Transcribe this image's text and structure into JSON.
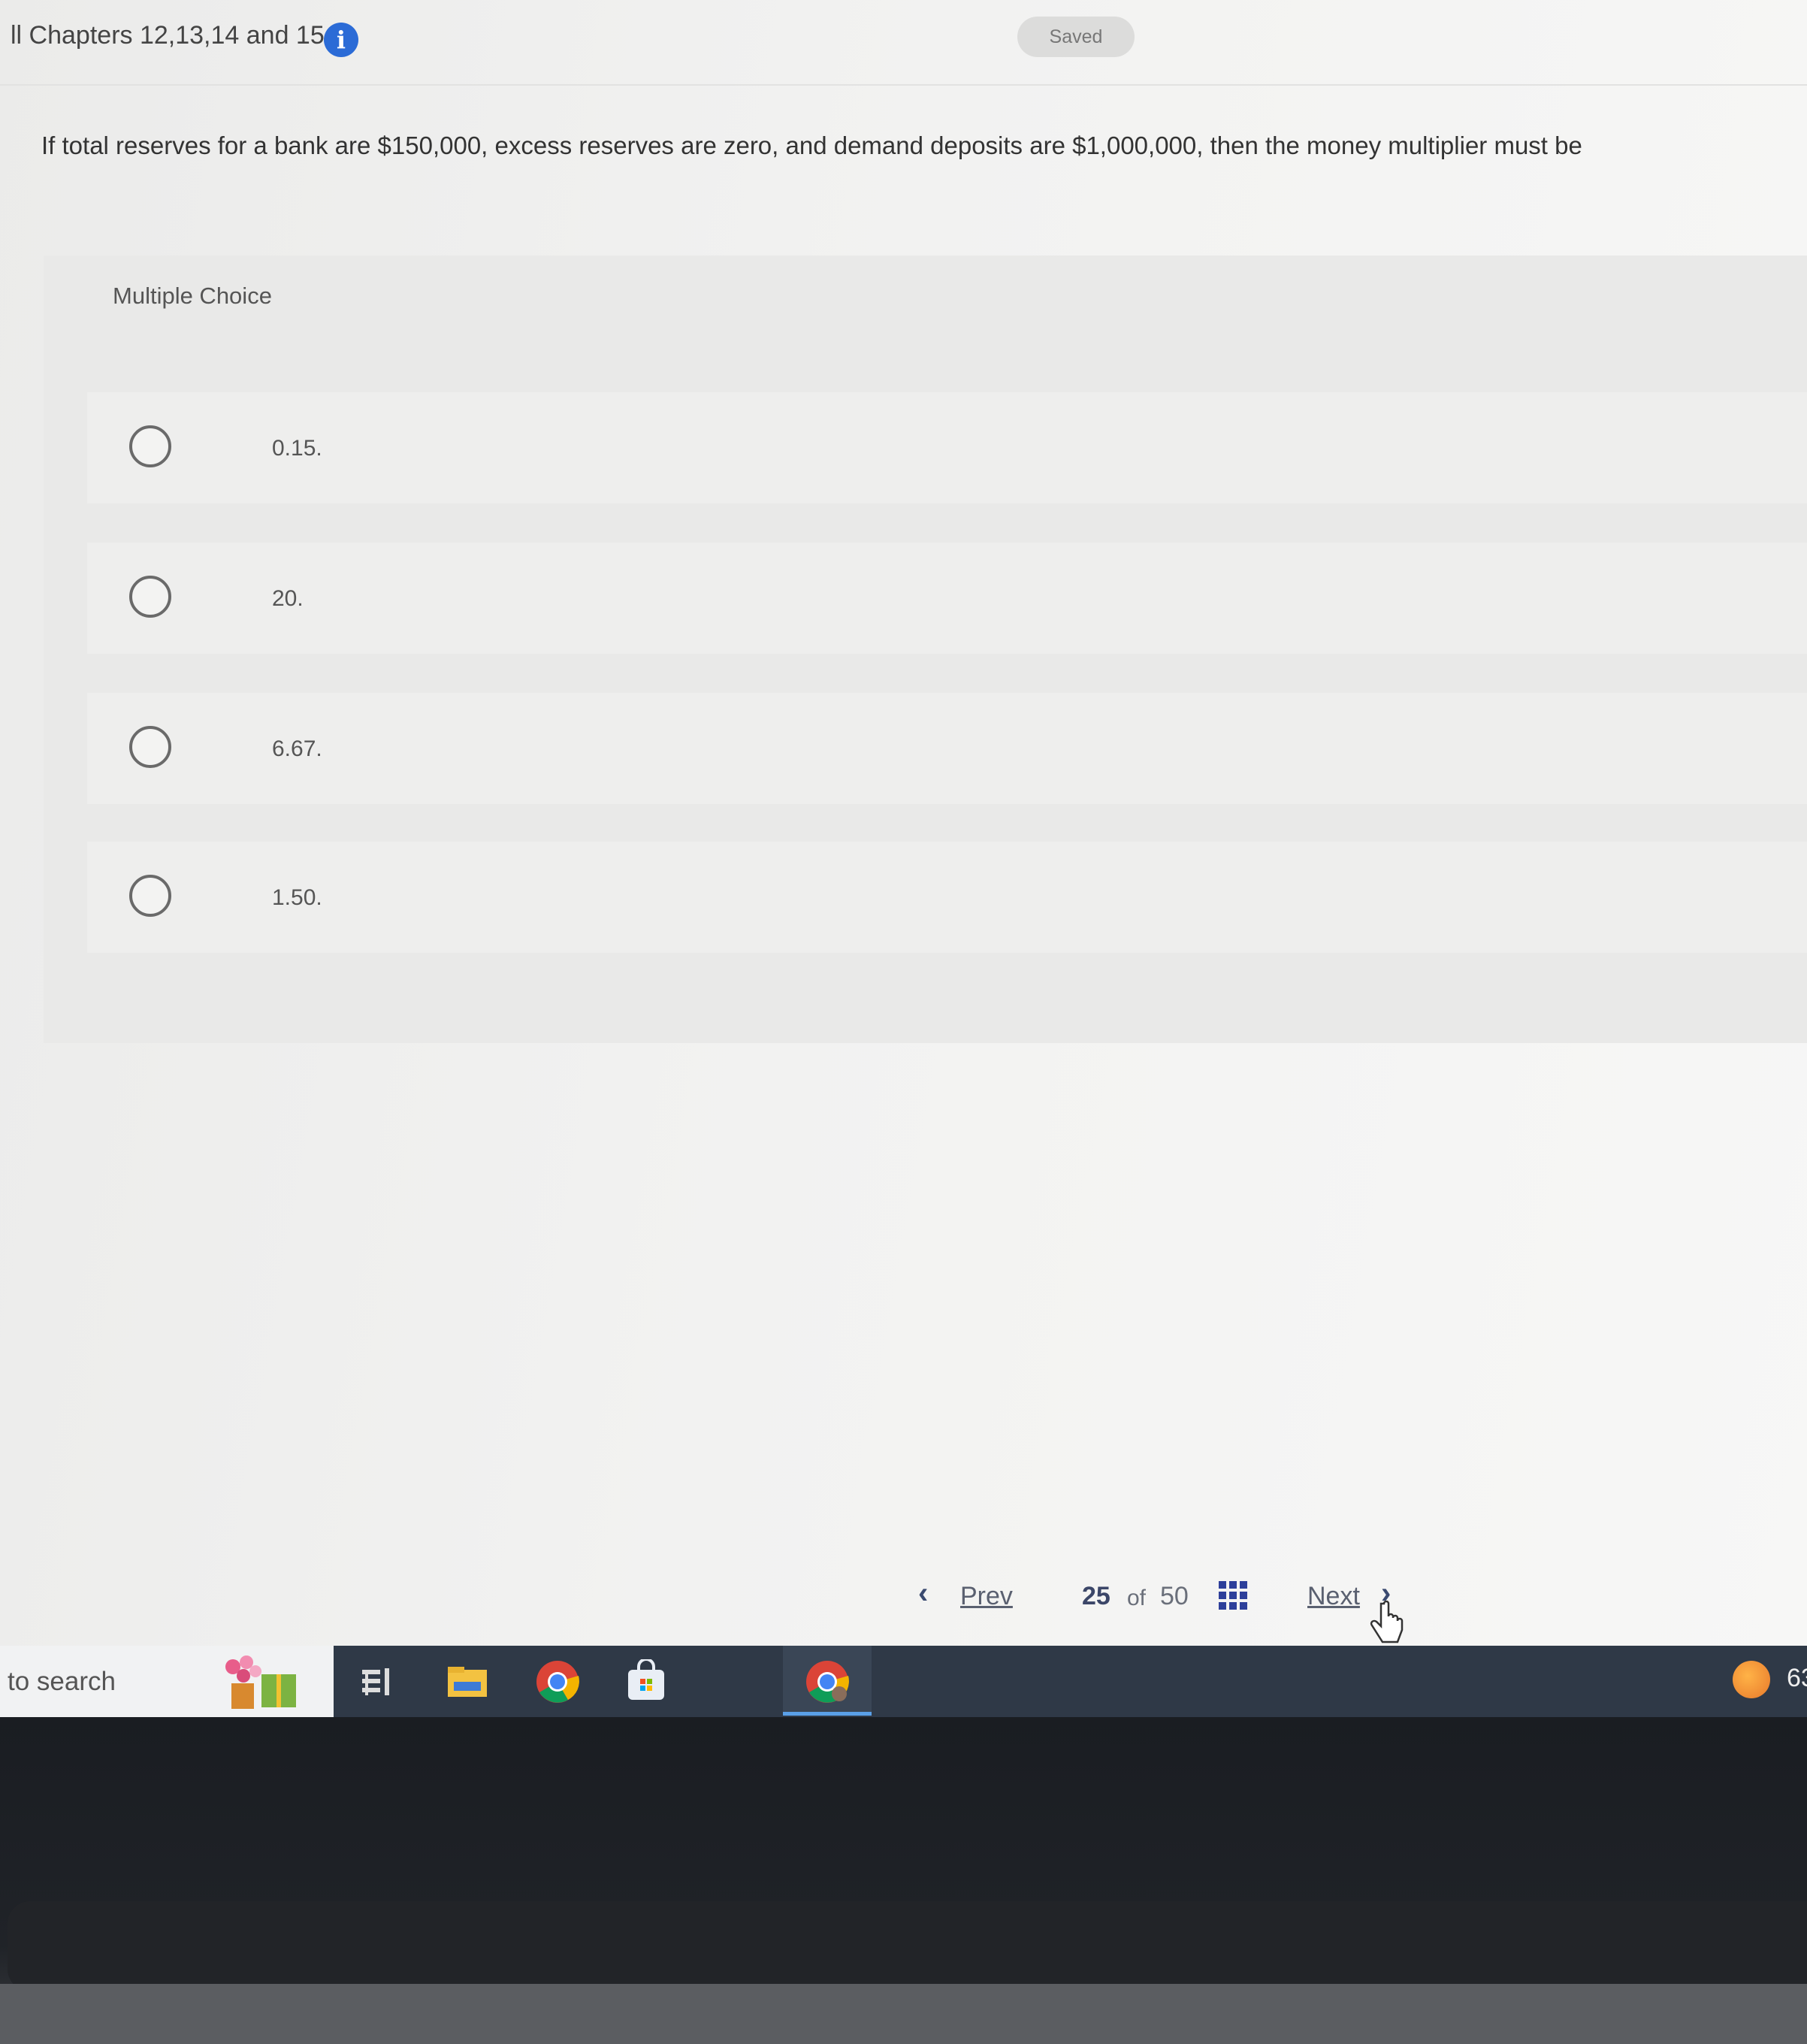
{
  "header": {
    "assignment_title": "ll Chapters 12,13,14 and 15",
    "saved_label": "Saved"
  },
  "question": {
    "text": "If total reserves for a bank are $150,000, excess reserves are zero, and demand deposits are $1,000,000, then the money multiplier must be"
  },
  "multiple_choice": {
    "label": "Multiple Choice",
    "options": [
      {
        "label": "0.15."
      },
      {
        "label": "20."
      },
      {
        "label": "6.67."
      },
      {
        "label": "1.50."
      }
    ]
  },
  "pagination": {
    "prev_label": "Prev",
    "current": "25",
    "of_label": "of",
    "total": "50",
    "next_label": "Next"
  },
  "taskbar": {
    "search_text": "to search",
    "weather_text": "63"
  },
  "colors": {
    "info_icon": "#2b6bd6",
    "taskbar": "#2f3947",
    "page_accent": "#2d3f9a"
  }
}
